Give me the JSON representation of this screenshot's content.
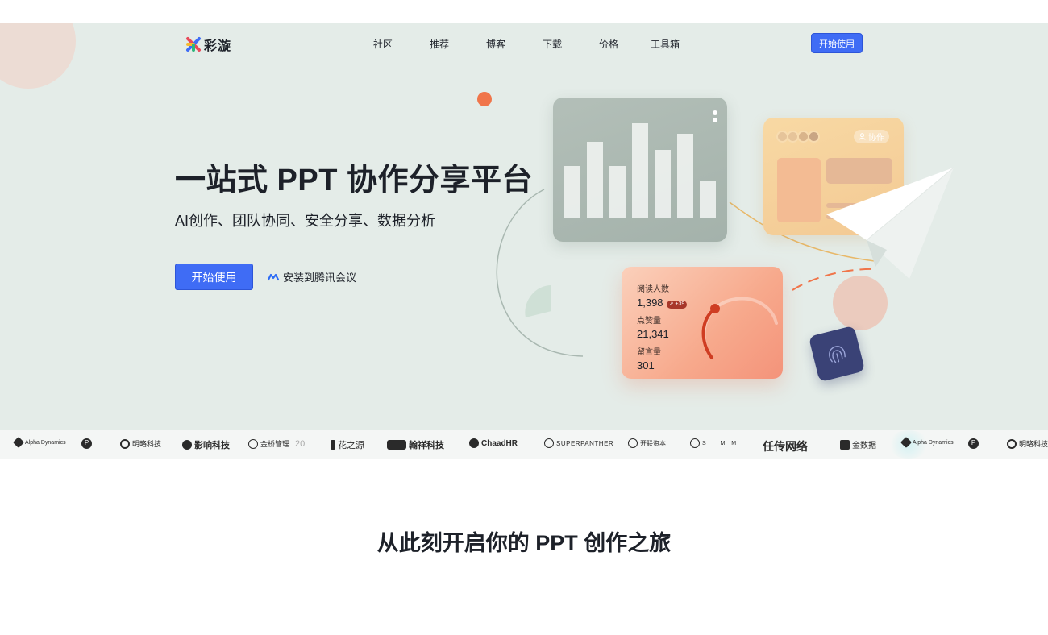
{
  "nav": {
    "logo_text": "彩漩",
    "links": [
      "社区",
      "推荐",
      "博客",
      "下载",
      "价格",
      "工具箱"
    ],
    "cta": "开始使用"
  },
  "hero": {
    "title": "一站式 PPT 协作分享平台",
    "subtitle": "AI创作、团队协同、安全分享、数据分析",
    "primary_button": "开始使用",
    "install_link": "安装到腾讯会议"
  },
  "illustration": {
    "collab_badge": "协作",
    "stats": [
      {
        "label": "阅读人数",
        "value": "1,398",
        "badge": "↗ +39"
      },
      {
        "label": "点赞量",
        "value": "21,341"
      },
      {
        "label": "留言量",
        "value": "301"
      }
    ]
  },
  "logos": [
    "Alpha Dynamics",
    "P",
    "明略科技",
    "影响科技",
    "金桥管理",
    "20",
    "花之源",
    "翰祥科技",
    "ChaadHR",
    "SUPERPANTHER",
    "开联资本",
    "S I M M",
    "任传网络",
    "金数据",
    "Alpha Dynamics",
    "P",
    "明略科技"
  ],
  "section": {
    "title": "从此刻开启你的 PPT 创作之旅"
  },
  "colors": {
    "accent": "#3f6cf5",
    "hero_bg": "#e4ece8",
    "orange": "#f0754a",
    "navy": "#3a4276"
  }
}
